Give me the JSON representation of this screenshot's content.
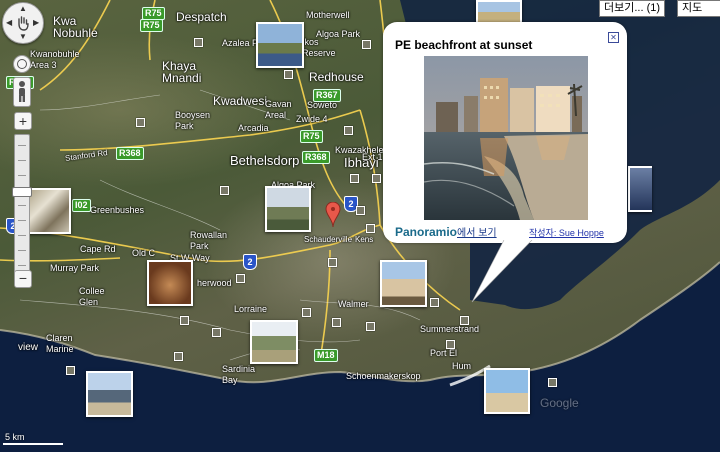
{
  "map": {
    "place_labels": [
      {
        "id": "kwa-nobuhle",
        "text": "Kwa\nNobuhle"
      },
      {
        "id": "despatch",
        "text": "Despatch"
      },
      {
        "id": "motherwell",
        "text": "Motherwell"
      },
      {
        "id": "azalea-park",
        "text": "Azalea P"
      },
      {
        "id": "kwanobuhle",
        "text": "Kwanobuhle\nArea 3"
      },
      {
        "id": "algoa-park-top",
        "text": "Algoa Park"
      },
      {
        "id": "khaya-mnandi",
        "text": "Khaya\nMnandi"
      },
      {
        "id": "kwadwesi",
        "text": "Kwadwesi"
      },
      {
        "id": "gavan",
        "text": "Gavan\nAreal"
      },
      {
        "id": "redhouse",
        "text": "Redhouse"
      },
      {
        "id": "soweto",
        "text": "Soweto"
      },
      {
        "id": "zwide",
        "text": "Zwide 4"
      },
      {
        "id": "booysen",
        "text": "Booysen\nPark"
      },
      {
        "id": "arcadia",
        "text": "Arcadia"
      },
      {
        "id": "bethelsdorp",
        "text": "Bethelsdorp"
      },
      {
        "id": "ibhayi",
        "text": "Ibhayi"
      },
      {
        "id": "kwazakhele",
        "text": "Kwazakhele"
      },
      {
        "id": "kwa-ext",
        "text": "Ext 1"
      },
      {
        "id": "algoa-park",
        "text": "Algoa Park"
      },
      {
        "id": "greenbushes",
        "text": "Greenbushes"
      },
      {
        "id": "stanford-rd",
        "text": "Stanford Rd"
      },
      {
        "id": "rowallan",
        "text": "Rowallan\nPark"
      },
      {
        "id": "cape-rd",
        "text": "Cape Rd"
      },
      {
        "id": "old-cape",
        "text": "Old C"
      },
      {
        "id": "murray-park",
        "text": "Murray Park"
      },
      {
        "id": "st-way",
        "text": "St W Way"
      },
      {
        "id": "schauderville",
        "text": "Schauderville"
      },
      {
        "id": "kensington",
        "text": "Kens"
      },
      {
        "id": "collee-glen",
        "text": "Collee\nGlen"
      },
      {
        "id": "sherwood",
        "text": "herwood"
      },
      {
        "id": "lorraine",
        "text": "Lorraine"
      },
      {
        "id": "walmer",
        "text": "Walmer"
      },
      {
        "id": "summerstrand",
        "text": "Summerstrand"
      },
      {
        "id": "clarendon",
        "text": "Claren\nMarine"
      },
      {
        "id": "sardinia",
        "text": "Sardinia\nBay"
      },
      {
        "id": "schoenmakerskop",
        "text": "Schoenmakerskop"
      },
      {
        "id": "view",
        "text": "view"
      },
      {
        "id": "port-el",
        "text": "Port El"
      },
      {
        "id": "hum",
        "text": "Hum"
      },
      {
        "id": "iko-reserve",
        "text": "Ikos\nReserve"
      },
      {
        "id": "google",
        "text": "Google"
      }
    ],
    "road_shields": [
      {
        "id": "r75a",
        "text": "R75"
      },
      {
        "id": "r75b",
        "text": "R75"
      },
      {
        "id": "r367",
        "text": "R367"
      },
      {
        "id": "r334",
        "text": "R334"
      },
      {
        "id": "r368a",
        "text": "R368"
      },
      {
        "id": "r368b",
        "text": "R368"
      },
      {
        "id": "r75c",
        "text": "R75"
      },
      {
        "id": "r102",
        "text": "I02"
      },
      {
        "id": "m18",
        "text": "M18"
      }
    ],
    "national_shields": [
      "2",
      "2",
      "2"
    ],
    "scale_text": "5 km",
    "colors": {
      "land": "#4b5a38",
      "sea": "#0c1c3a",
      "shield_regional": "#3a9a2a",
      "shield_national": "#2a55c8"
    }
  },
  "controls": {
    "pan_icon": "hand-icon",
    "streetview_icon": "pegman-icon",
    "zoom_in": "+",
    "zoom_out": "−"
  },
  "top_buttons": {
    "more_label": "더보기... (1)",
    "map_label": "지도"
  },
  "popup": {
    "title": "PE beachfront at sunset",
    "brand": "Panoramio",
    "view_link": "에서 보기",
    "author_link": "작성자: Sue Hoppe"
  }
}
